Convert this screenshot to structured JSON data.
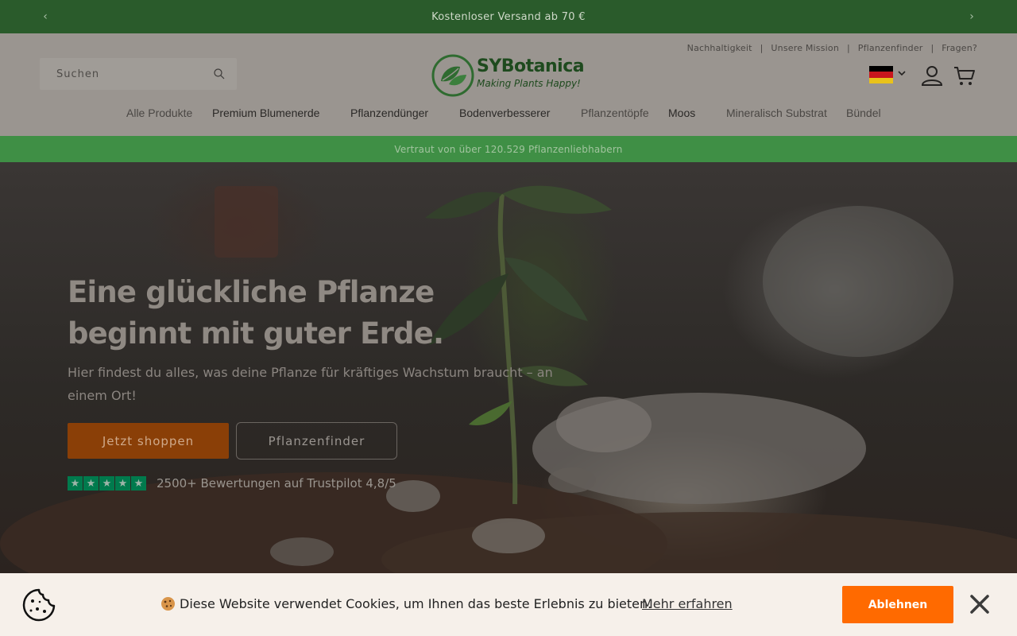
{
  "announcement": {
    "text": "Kostenloser Versand ab 70 €",
    "prev_icon": "chevron-left-icon",
    "next_icon": "chevron-right-icon"
  },
  "header": {
    "search_placeholder": "Suchen",
    "logo": {
      "name": "SYBotanica",
      "tagline": "Making Plants Happy!"
    },
    "top_links": [
      "Nachhaltigkeit",
      "Unsere Mission",
      "Pflanzenfinder",
      "Fragen?"
    ],
    "top_links_separator": "|",
    "language": {
      "flag": "germany-flag-icon",
      "chevron": "⌄"
    },
    "account_icon": "account-icon",
    "cart_icon": "cart-icon"
  },
  "nav": {
    "items": [
      "Alle Produkte",
      "Premium Blumenerde",
      "Pflanzendünger",
      "Bodenverbesserer",
      "Pflanzentöpfe",
      "Moos",
      "Mineralisch Substrat",
      "Bündel"
    ]
  },
  "trust_banner": {
    "text": "Vertraut von über 120.529 Pflanzenliebhabern"
  },
  "hero": {
    "title_line1": "Eine glückliche Pflanze",
    "title_line2": "beginnt mit guter Erde.",
    "subtitle": "Hier findest du alles, was deine Pflanze für kräftiges Wachstum braucht – an einem Ort!",
    "primary_button": "Jetzt shoppen",
    "secondary_button": "Pflanzenfinder",
    "rating_stars": 5,
    "rating_text": "2500+ Bewertungen auf Trustpilot 4,8/5"
  },
  "cookie_bar": {
    "text": "Diese Website verwendet Cookies, um Ihnen das beste Erlebnis zu bieten.",
    "learn_more": "Mehr erfahren",
    "decline_button": "Ablehnen",
    "close_icon": "close-icon"
  },
  "colors": {
    "announcement_bg": "#2a5b2b",
    "trust_bg": "#3f8f45",
    "primary_button": "#ff6a00",
    "brand_green": "#2f7d32"
  }
}
